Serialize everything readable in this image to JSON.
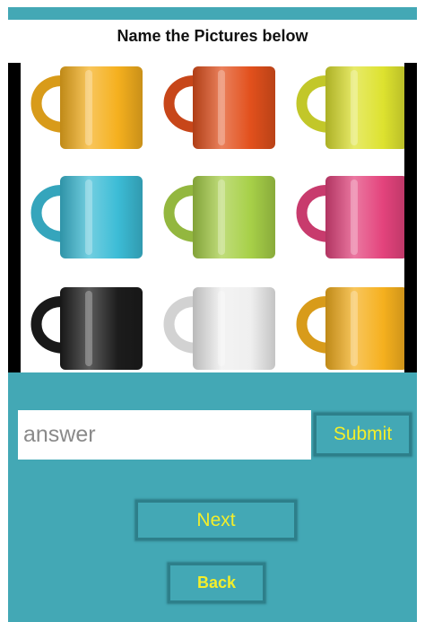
{
  "header": {
    "title": "Name the Pictures below"
  },
  "picture": {
    "subject": "mugs",
    "mug_colors": [
      [
        "#f5b01e",
        "#e2501c",
        "#dde22f"
      ],
      [
        "#3cbcd6",
        "#a7d048",
        "#e3437c"
      ],
      [
        "#1c1c1c",
        "#efefef",
        "#f5b01e"
      ]
    ]
  },
  "answer": {
    "value": "",
    "placeholder": "answer"
  },
  "buttons": {
    "submit_label": "Submit",
    "next_label": "Next",
    "back_label": "Back"
  },
  "colors": {
    "accent": "#43a8b5",
    "button_text": "#f4ee2a",
    "button_border": "#2d7f8a"
  }
}
